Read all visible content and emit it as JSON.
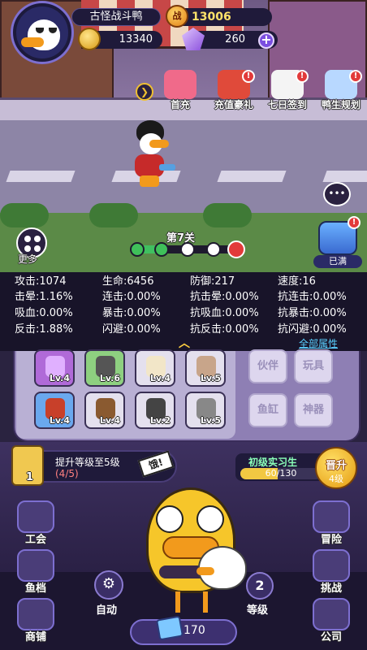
{
  "player": {
    "name": "古怪战斗鸭",
    "power_icon_text": "战",
    "power": "13006",
    "coins": "13340",
    "gems": "260"
  },
  "events": [
    {
      "label": "首充",
      "color": "#f06a8a",
      "badge": ""
    },
    {
      "label": "充值豪礼",
      "color": "#e04a3a",
      "badge": "!"
    },
    {
      "label": "七日签到",
      "color": "#f4f4f4",
      "badge": "!"
    },
    {
      "label": "鸭生规划",
      "color": "#b8d8ff",
      "badge": "!"
    }
  ],
  "stage": {
    "title": "第7关",
    "more_label": "更多",
    "chest_label": "已满",
    "chest_badge": "!",
    "chat_icon": "chat-bubble-icon"
  },
  "stats": [
    [
      "攻击:1074",
      "生命:6456",
      "防御:217",
      "速度:16"
    ],
    [
      "击晕:1.16%",
      "连击:0.00%",
      "抗击晕:0.00%",
      "抗连击:0.00%"
    ],
    [
      "吸血:0.00%",
      "暴击:0.00%",
      "抗吸血:0.00%",
      "抗暴击:0.00%"
    ],
    [
      "反击:1.88%",
      "闪避:0.00%",
      "抗反击:0.00%",
      "抗闪避:0.00%"
    ]
  ],
  "all_attrs_label": "全部属性",
  "bag": {
    "slots": [
      {
        "lv": "Lv.4",
        "bg": "#b06ad8",
        "item": "#e0b0ff"
      },
      {
        "lv": "Lv.6",
        "bg": "#8ed080",
        "item": "#555"
      },
      {
        "lv": "Lv.4",
        "bg": "#e4e0ee",
        "item": "#f2e6c8"
      },
      {
        "lv": "Lv.5",
        "bg": "#e4e0ee",
        "item": "#c8a58a"
      },
      {
        "lv": "Lv.4",
        "bg": "#6aa8ee",
        "item": "#c8402a"
      },
      {
        "lv": "Lv.4",
        "bg": "#e4e0ee",
        "item": "#8a5a30"
      },
      {
        "lv": "Lv.2",
        "bg": "#e4e0ee",
        "item": "#444"
      },
      {
        "lv": "Lv.5",
        "bg": "#e4e0ee",
        "item": "#888"
      }
    ],
    "side_buttons": [
      "伙伴",
      "玩具",
      "鱼缸",
      "神器"
    ]
  },
  "task": {
    "number": "1",
    "text": "提升等级至5级",
    "progress": "(4/5)"
  },
  "rank": {
    "title": "初级实习生",
    "value_text": "60/130",
    "fraction": 0.46,
    "promote": "晋升",
    "promote_sub": "4级"
  },
  "duck_shout": "饿!",
  "nav_left": [
    "工会",
    "鱼档",
    "商铺"
  ],
  "nav_right": [
    "冒险",
    "挑战",
    "公司"
  ],
  "auto_label": "自动",
  "level_value": "2",
  "level_label": "等级",
  "bottom_value": "170"
}
